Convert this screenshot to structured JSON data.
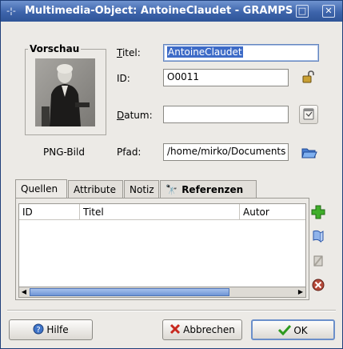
{
  "window": {
    "title": "Multimedia-Object: AntoineClaudet - GRAMPS",
    "menu_glyph": "-¦-",
    "minimize_glyph": "□",
    "close_glyph": "✕"
  },
  "preview": {
    "legend": "Vorschau",
    "mime_label": "PNG-Bild"
  },
  "form": {
    "title_label": "Titel:",
    "title_value": "AntoineClaudet",
    "id_label": "ID:",
    "id_value": "O0011",
    "date_label": "Datum:",
    "date_value": "",
    "path_label": "Pfad:",
    "path_value": "/home/mirko/Documents"
  },
  "tabs": [
    {
      "label": "Quellen"
    },
    {
      "label": "Attribute"
    },
    {
      "label": "Notiz"
    },
    {
      "label": "Referenzen"
    }
  ],
  "table": {
    "columns": [
      "ID",
      "Titel",
      "Autor"
    ]
  },
  "buttons": {
    "help": "Hilfe",
    "cancel": "Abbrechen",
    "ok": "OK"
  },
  "colors": {
    "titlebar": "#3d64ab",
    "selection": "#3d6bc7",
    "window_bg": "#eceae6"
  }
}
